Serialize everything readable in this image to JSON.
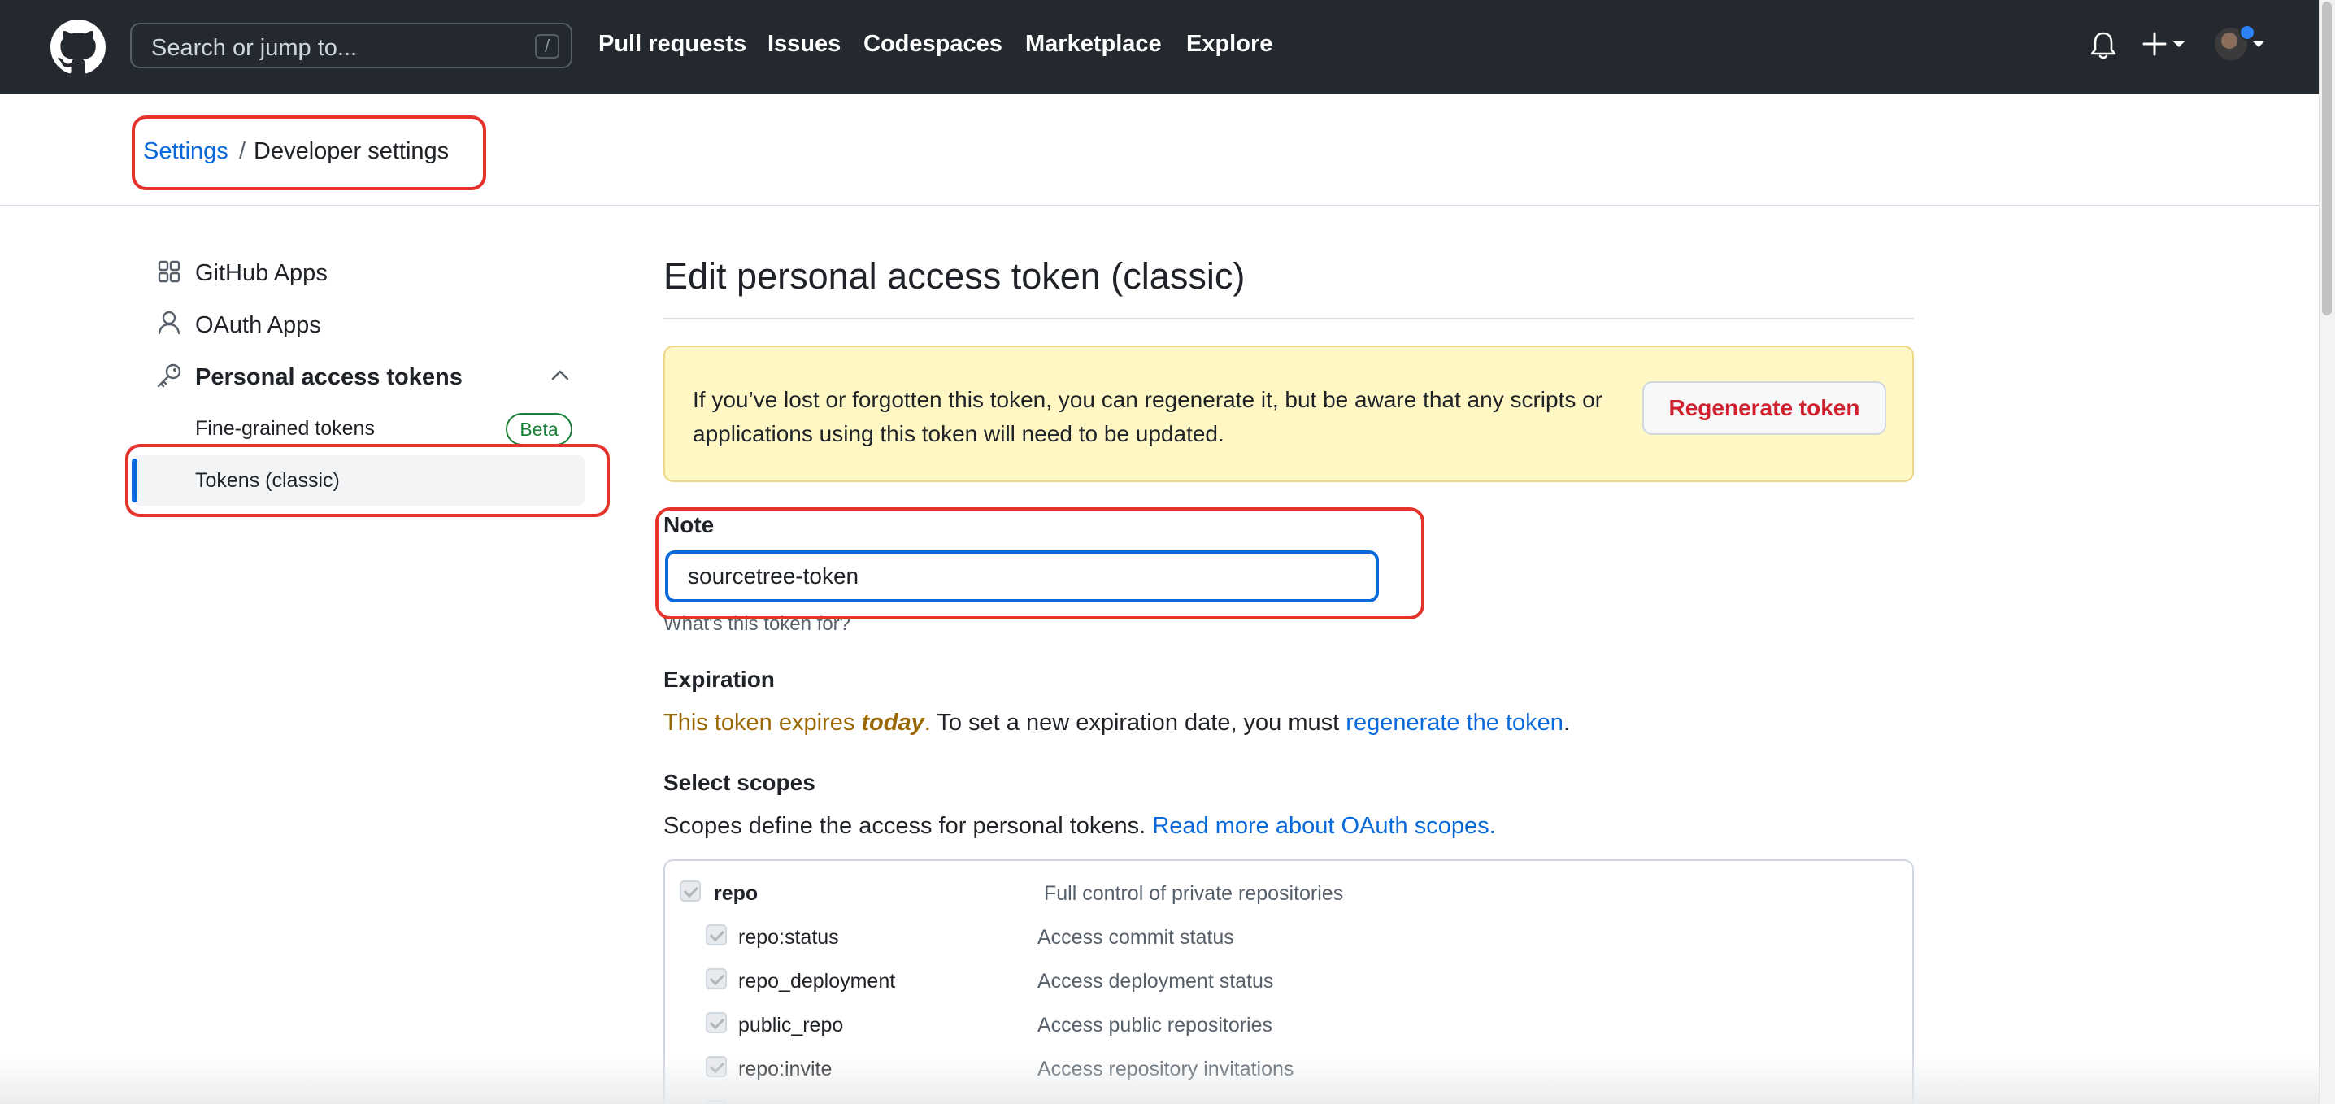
{
  "header": {
    "search_placeholder": "Search or jump to...",
    "search_shortcut": "/",
    "nav": [
      "Pull requests",
      "Issues",
      "Codespaces",
      "Marketplace",
      "Explore"
    ]
  },
  "breadcrumb": {
    "parent": "Settings",
    "separator": "/",
    "current": "Developer settings"
  },
  "sidebar": {
    "items": [
      {
        "label": "GitHub Apps",
        "icon": "apps-grid-icon"
      },
      {
        "label": "OAuth Apps",
        "icon": "person-icon"
      },
      {
        "label": "Personal access tokens",
        "icon": "key-icon",
        "expanded": true
      }
    ],
    "subitems": [
      {
        "label": "Fine-grained tokens",
        "badge": "Beta"
      },
      {
        "label": "Tokens (classic)",
        "active": true
      }
    ]
  },
  "main": {
    "title": "Edit personal access token (classic)",
    "flash": {
      "text": "If you’ve lost or forgotten this token, you can regenerate it, but be aware that any scripts or applications using this token will need to be updated.",
      "button": "Regenerate token"
    },
    "note": {
      "label": "Note",
      "value": "sourcetree-token",
      "hint": "What's this token for?"
    },
    "expiration": {
      "label": "Expiration",
      "warn_prefix": "This token expires ",
      "warn_emphasis": "today",
      "warn_suffix": ".",
      "text_after": " To set a new expiration date, you must ",
      "link": "regenerate the token",
      "end": "."
    },
    "scopes": {
      "label": "Select scopes",
      "description": "Scopes define the access for personal tokens.",
      "link": "Read more about OAuth scopes.",
      "rows": [
        {
          "name": "repo",
          "description": "Full control of private repositories",
          "checked": true,
          "level": 0
        },
        {
          "name": "repo:status",
          "description": "Access commit status",
          "checked": true,
          "level": 1
        },
        {
          "name": "repo_deployment",
          "description": "Access deployment status",
          "checked": true,
          "level": 1
        },
        {
          "name": "public_repo",
          "description": "Access public repositories",
          "checked": true,
          "level": 1
        },
        {
          "name": "repo:invite",
          "description": "Access repository invitations",
          "checked": true,
          "level": 1
        }
      ]
    }
  },
  "colors": {
    "header_bg": "#24292f",
    "link": "#0969da",
    "danger": "#cf222e",
    "success": "#1a7f37",
    "warning_bg": "#fff8c5",
    "annotation_red": "#e5322d"
  }
}
